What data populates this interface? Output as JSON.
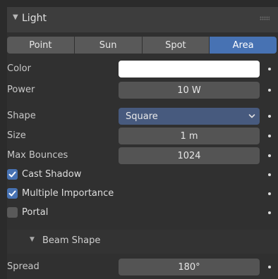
{
  "panel": {
    "title": "Light",
    "collapse_icon": "triangle-down-icon"
  },
  "light_types": {
    "items": [
      "Point",
      "Sun",
      "Spot",
      "Area"
    ],
    "selected": "Area"
  },
  "properties": {
    "color": {
      "label": "Color",
      "value_hex": "#ffffff"
    },
    "power": {
      "label": "Power",
      "value": "10 W"
    },
    "shape": {
      "label": "Shape",
      "value": "Square"
    },
    "size": {
      "label": "Size",
      "value": "1 m"
    },
    "max_bounces": {
      "label": "Max Bounces",
      "value": "1024"
    }
  },
  "checkboxes": {
    "cast_shadow": {
      "label": "Cast Shadow",
      "checked": true
    },
    "multiple_importance": {
      "label": "Multiple Importance",
      "checked": true
    },
    "portal": {
      "label": "Portal",
      "checked": false
    }
  },
  "beam_shape": {
    "title": "Beam Shape",
    "spread": {
      "label": "Spread",
      "value": "180°"
    }
  },
  "colors": {
    "accent": "#4772b3",
    "panel_bg": "#303030",
    "header_bg": "#3d3d3d",
    "field_bg": "#545454",
    "select_bg": "#475a7e"
  }
}
